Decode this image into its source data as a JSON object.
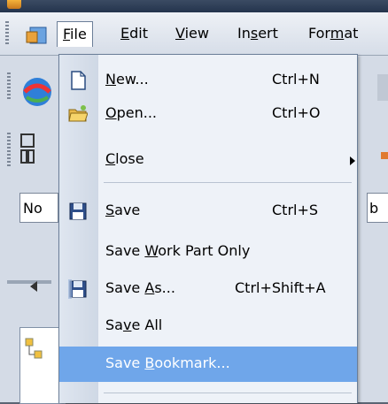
{
  "menubar": {
    "items": [
      "File",
      "Edit",
      "View",
      "Insert",
      "Format"
    ],
    "active": "File"
  },
  "background_combo": {
    "left_value": "No",
    "right_value": "b"
  },
  "file_menu": {
    "items": [
      {
        "label_pre": "",
        "label_u": "N",
        "label_post": "ew...",
        "shortcut": "Ctrl+N",
        "icon": "new-file-icon"
      },
      {
        "label_pre": "",
        "label_u": "O",
        "label_post": "pen...",
        "shortcut": "Ctrl+O",
        "icon": "open-folder-icon"
      },
      {
        "label_pre": "",
        "label_u": "C",
        "label_post": "lose",
        "shortcut": "",
        "icon": "",
        "submenu": true
      },
      {
        "label_pre": "",
        "label_u": "S",
        "label_post": "ave",
        "shortcut": "Ctrl+S",
        "icon": "save-icon"
      },
      {
        "label_pre": "Save ",
        "label_u": "W",
        "label_post": "ork Part Only",
        "shortcut": "",
        "icon": ""
      },
      {
        "label_pre": "Save ",
        "label_u": "A",
        "label_post": "s...",
        "shortcut": "Ctrl+Shift+A",
        "icon": "save-as-icon"
      },
      {
        "label_pre": "Sa",
        "label_u": "v",
        "label_post": "e All",
        "shortcut": "",
        "icon": ""
      },
      {
        "label_pre": "Save ",
        "label_u": "B",
        "label_post": "ookmark...",
        "shortcut": "",
        "icon": "",
        "highlighted": true
      }
    ]
  },
  "colors": {
    "highlight": "#6fa6ea",
    "menu_bg": "#eef2f8",
    "menu_border": "#6b7e98"
  }
}
